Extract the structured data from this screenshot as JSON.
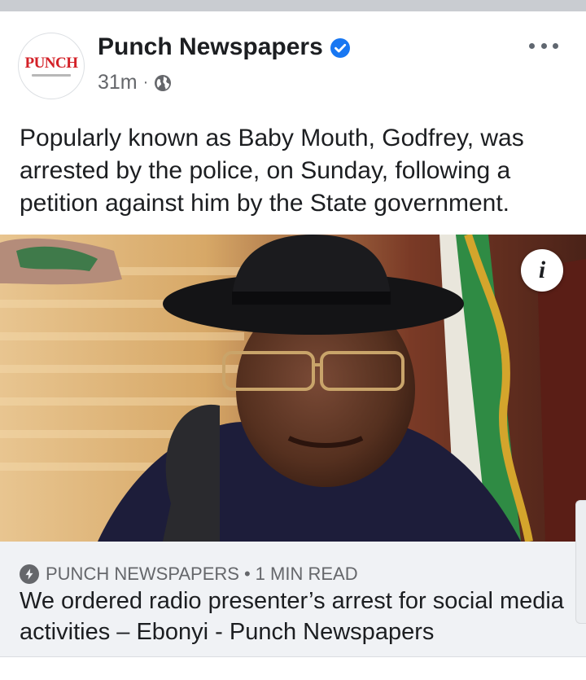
{
  "post": {
    "page_name": "Punch Newspapers",
    "avatar_text": "PUNCH",
    "timestamp": "31m",
    "separator": "·",
    "privacy_icon": "globe-icon",
    "verified_icon": "verified-badge-icon",
    "more_icon": "more-options-icon",
    "message": "Popularly known as Baby Mouth, Godfrey, was arrested by the police, on Sunday, following a petition against him by the State government."
  },
  "link": {
    "image_info_label": "i",
    "source_icon": "bolt-icon",
    "source_name": "PUNCH NEWSPAPERS",
    "separator": "•",
    "read_time": "1 MIN READ",
    "headline": "We ordered radio presenter’s arrest for social media activities – Ebonyi - Punch Newspapers"
  },
  "colors": {
    "verified": "#1877f2",
    "brand_red": "#d32027",
    "secondary_text": "#65676b",
    "link_background": "#f0f2f5"
  }
}
